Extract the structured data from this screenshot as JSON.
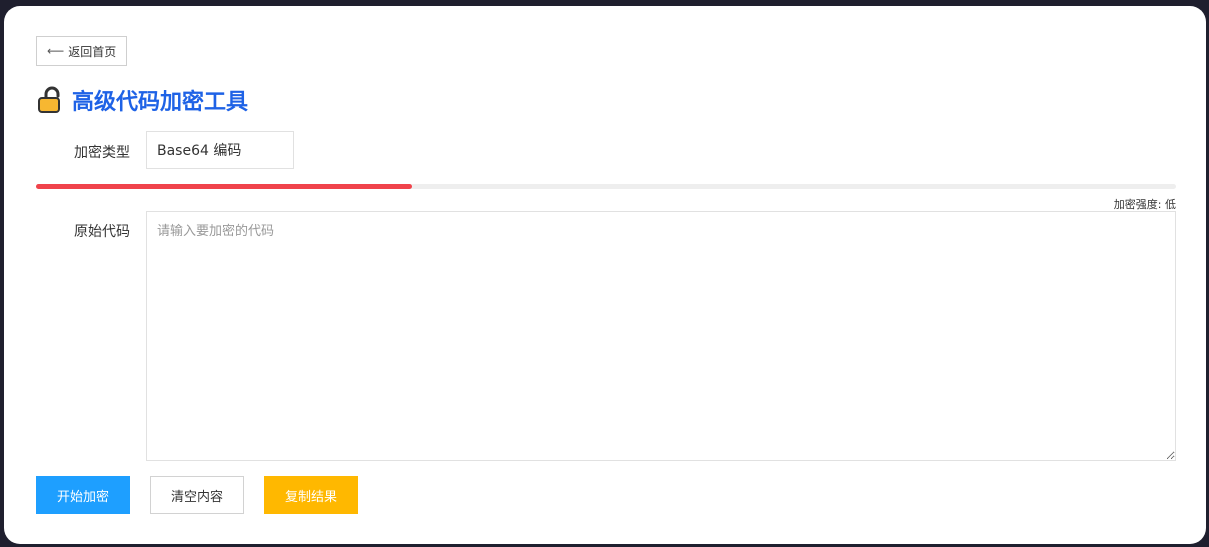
{
  "back_button": {
    "label": "返回首页",
    "icon": "arrow-left-icon"
  },
  "header": {
    "title": "高级代码加密工具",
    "icon": "lock-icon"
  },
  "form": {
    "encrypt_type_label": "加密类型",
    "encrypt_type_value": "Base64 编码",
    "strength_label": "加密强度: 低",
    "strength_level": 0.33,
    "code_label": "原始代码",
    "code_placeholder": "请输入要加密的代码",
    "code_value": ""
  },
  "actions": {
    "start_label": "开始加密",
    "clear_label": "清空内容",
    "copy_label": "复制结果"
  },
  "colors": {
    "title": "#1e62e6",
    "strength_fill": "#f0434b",
    "start_button": "#1e9fff",
    "copy_button": "#ffb800"
  }
}
